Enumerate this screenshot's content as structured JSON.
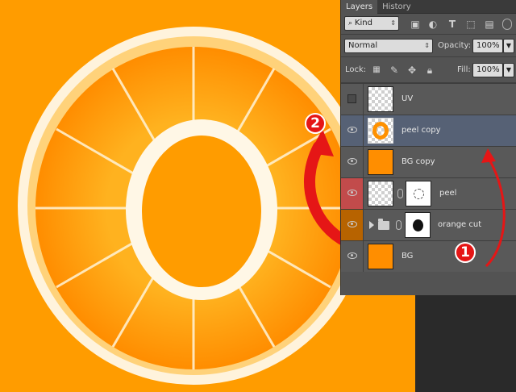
{
  "panel": {
    "tabs": [
      {
        "label": "Layers",
        "active": true
      },
      {
        "label": "History",
        "active": false
      }
    ],
    "filter": {
      "value": "Kind"
    },
    "blend_mode": {
      "value": "Normal"
    },
    "opacity": {
      "label": "Opacity:",
      "value": "100%"
    },
    "lock": {
      "label": "Lock:"
    },
    "fill": {
      "label": "Fill:",
      "value": "100%"
    },
    "layers": [
      {
        "name": "UV",
        "visible": false,
        "selected": false
      },
      {
        "name": "peel copy",
        "visible": true,
        "selected": true
      },
      {
        "name": "BG copy",
        "visible": true,
        "selected": false
      },
      {
        "name": "peel",
        "visible": true,
        "selected": false,
        "color": "#c24b4b"
      },
      {
        "name": "orange cut",
        "visible": true,
        "selected": false,
        "color": "#b76300",
        "group": true
      },
      {
        "name": "BG",
        "visible": true,
        "selected": false
      }
    ]
  },
  "annotations": {
    "step1": "1",
    "step2": "2"
  },
  "colors": {
    "canvas": "#ff9c00",
    "panel": "#535353",
    "selected_layer": "#566175",
    "arrow": "#e51616"
  }
}
